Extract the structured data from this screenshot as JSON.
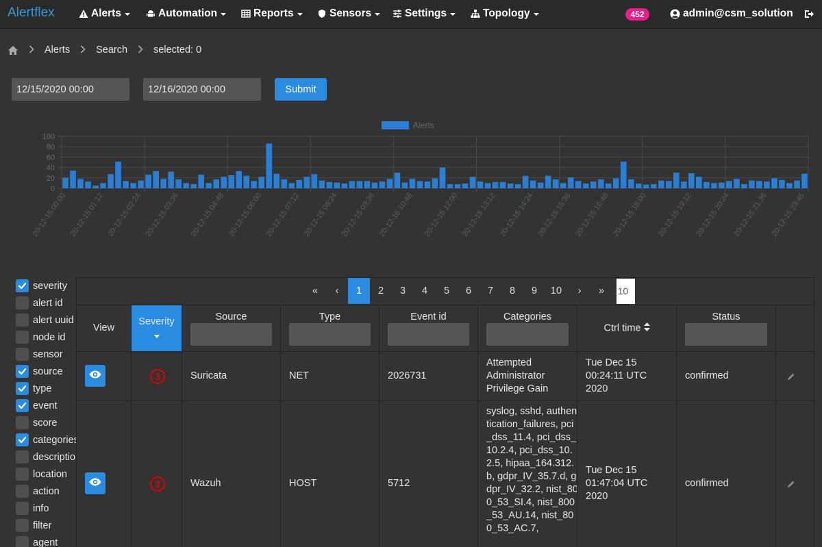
{
  "nav": {
    "brand": "Alertflex",
    "items": [
      {
        "label": "Alerts",
        "icon": "warning-icon"
      },
      {
        "label": "Automation",
        "icon": "android-icon"
      },
      {
        "label": "Reports",
        "icon": "table-icon"
      },
      {
        "label": "Sensors",
        "icon": "shield-icon"
      },
      {
        "label": "Settings",
        "icon": "sliders-icon"
      },
      {
        "label": "Topology",
        "icon": "sitemap-icon"
      }
    ],
    "badge": "452",
    "user": "admin@csm_solution"
  },
  "breadcrumb": {
    "items": [
      "Alerts",
      "Search",
      "selected: 0"
    ]
  },
  "dates": {
    "from": "12/15/2020 00:00",
    "to": "12/16/2020 00:00",
    "submit": "Submit"
  },
  "chart_data": {
    "type": "bar",
    "legend": "Alerts",
    "legend_position": "top-center",
    "ylim": [
      0,
      100
    ],
    "yticks": [
      0,
      20,
      40,
      60,
      80,
      100
    ],
    "grid": true,
    "color": "#2a7fd4",
    "tick_labels": [
      "20-12-15 00:00",
      "20-12-15 01:12",
      "20-12-15 02:24",
      "20-12-15 03:36",
      "20-12-15 04:48",
      "20-12-15 06:00",
      "20-12-15 07:12",
      "20-12-15 08:24",
      "20-12-15 09:36",
      "20-12-15 10:48",
      "20-12-15 12:00",
      "20-12-15 13:12",
      "20-12-15 14:24",
      "20-12-15 15:36",
      "20-12-15 16:48",
      "20-12-15 18:00",
      "20-12-15 19:12",
      "20-12-15 20:24",
      "20-12-15 21:36",
      "20-12-15 23:45"
    ],
    "values": [
      20,
      34,
      18,
      13,
      5,
      10,
      27,
      51,
      14,
      10,
      15,
      26,
      33,
      18,
      32,
      17,
      10,
      8,
      26,
      10,
      17,
      22,
      25,
      33,
      24,
      14,
      22,
      86,
      28,
      17,
      10,
      16,
      22,
      27,
      15,
      12,
      11,
      9,
      14,
      14,
      14,
      11,
      13,
      18,
      30,
      11,
      18,
      14,
      13,
      19,
      40,
      8,
      8,
      9,
      22,
      13,
      10,
      12,
      12,
      9,
      8,
      24,
      15,
      11,
      24,
      17,
      10,
      21,
      14,
      9,
      13,
      17,
      9,
      19,
      51,
      17,
      9,
      7,
      8,
      15,
      14,
      30,
      13,
      29,
      22,
      12,
      10,
      11,
      14,
      18,
      8,
      15,
      14,
      13,
      19,
      16,
      10,
      15,
      28
    ]
  },
  "columns": [
    {
      "label": "severity",
      "checked": true
    },
    {
      "label": "alert id",
      "checked": false
    },
    {
      "label": "alert uuid",
      "checked": false
    },
    {
      "label": "node id",
      "checked": false
    },
    {
      "label": "sensor",
      "checked": false
    },
    {
      "label": "source",
      "checked": true
    },
    {
      "label": "type",
      "checked": true
    },
    {
      "label": "event",
      "checked": true
    },
    {
      "label": "score",
      "checked": false
    },
    {
      "label": "categories",
      "checked": true
    },
    {
      "label": "description",
      "checked": false
    },
    {
      "label": "location",
      "checked": false
    },
    {
      "label": "action",
      "checked": false
    },
    {
      "label": "info",
      "checked": false
    },
    {
      "label": "filter",
      "checked": false
    },
    {
      "label": "agent",
      "checked": false
    }
  ],
  "pager": {
    "first": "«",
    "prev": "‹",
    "pages": [
      "1",
      "2",
      "3",
      "4",
      "5",
      "6",
      "7",
      "8",
      "9",
      "10"
    ],
    "active": "1",
    "next": "›",
    "last": "»",
    "page_size": "10"
  },
  "table": {
    "headers": {
      "view": "View",
      "severity": "Severity",
      "source": "Source",
      "type": "Type",
      "event_id": "Event id",
      "categories": "Categories",
      "ctrl_time": "Ctrl time",
      "status": "Status"
    },
    "rows": [
      {
        "severity": "3",
        "source": "Suricata",
        "type": "NET",
        "event_id": "2026731",
        "categories": "Attempted Administrator Privilege Gain",
        "ctrl_time": "Tue Dec 15 00:24:11 UTC 2020",
        "status": "confirmed"
      },
      {
        "severity": "3",
        "source": "Wazuh",
        "type": "HOST",
        "event_id": "5712",
        "categories": "syslog, sshd, authentication_failures, pci_dss_11.4, pci_dss_10.2.4, pci_dss_10.2.5, hipaa_164.312.b, gdpr_IV_35.7.d, gdpr_IV_32.2, nist_800_53_SI.4, nist_800_53_AU.14, nist_800_53_AC.7,",
        "ctrl_time": "Tue Dec 15 01:47:04 UTC 2020",
        "status": "confirmed"
      }
    ]
  }
}
